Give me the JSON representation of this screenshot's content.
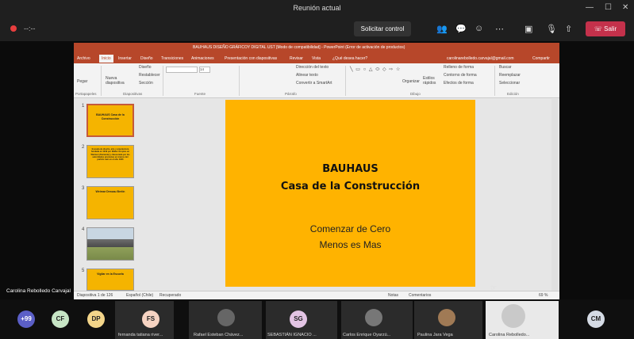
{
  "window": {
    "title": "Reunión actual",
    "minimize": "—",
    "maximize": "☐",
    "close": "✕"
  },
  "callbar": {
    "timer": "--:--",
    "request_control": "Solicitar control",
    "leave": "Salir",
    "icons": [
      "people-icon",
      "chat-icon",
      "reactions-icon",
      "more-icon",
      "camera-off-icon",
      "mic-off-icon",
      "share-icon"
    ]
  },
  "ppt": {
    "title": "BAUHAUS DISEÑO GRÁFICOY DIGITAL UST [Modo de compatibilidad] - PowerPoint (Error de activación de productos)",
    "tabs": [
      "Archivo",
      "Inicio",
      "Insertar",
      "Diseño",
      "Transiciones",
      "Animaciones",
      "Presentación con diapositivas",
      "Revisar",
      "Vista",
      "¿Qué desea hacer?"
    ],
    "active_tab": "Inicio",
    "account": "carolinarebolledo.carvajal@gmail.com",
    "share": "Compartir",
    "ribbon": {
      "paste": "Pegar",
      "new_slide": "Nueva diapositiva",
      "design": "Diseño",
      "reset": "Restablecer",
      "section": "Sección",
      "font_size": "14",
      "text_direction": "Dirección del texto",
      "align_text": "Alinear texto",
      "smartart": "Convertir a SmartArt",
      "arrange": "Organizar",
      "quick_styles": "Estilos rápidos",
      "shape_fill": "Relleno de forma",
      "shape_outline": "Contorno de forma",
      "shape_effects": "Efectos de forma",
      "find": "Buscar",
      "replace": "Reemplazar",
      "select": "Seleccionar",
      "groups": [
        "Portapapeles",
        "Diapositivas",
        "Fuente",
        "Párrafo",
        "Dibujo",
        "Edición"
      ]
    },
    "thumbnails": [
      {
        "num": "1",
        "text": "BAUHAUS Casa de la Construcción"
      },
      {
        "num": "2",
        "text": "Escuela de diseño, arte y arquitectura fundada en 1919 por Walter Gropius en Weimar (Alemania) y clausurada por las autoridades prusianas en manos del partido nazi en el año 1933"
      },
      {
        "num": "3",
        "text": "Weimar Dessau Berlín"
      },
      {
        "num": "4",
        "text": ""
      },
      {
        "num": "5",
        "text": "Vigilar en la Escuela"
      }
    ],
    "slide": {
      "title_line1": "BAUHAUS",
      "title_line2": "Casa de la Construcción",
      "sub_line1": "Comenzar de Cero",
      "sub_line2": "Menos es Mas"
    },
    "status": {
      "slide_info": "Diapositiva 1 de 126",
      "language": "Español (Chile)",
      "recovered": "Recuperado",
      "notes": "Notas",
      "comments": "Comentarios",
      "zoom": "69 %"
    }
  },
  "speaker": "Carolina Rebolledo Carvajal",
  "participants": [
    {
      "initials": "+99",
      "name": "",
      "color": "#5b5fc7"
    },
    {
      "initials": "CF",
      "name": "",
      "color": "#c7e5c5"
    },
    {
      "initials": "DP",
      "name": "",
      "color": "#f3d58a"
    },
    {
      "initials": "FS",
      "name": "fernanda tatiana river...",
      "color": "#f6d3c2"
    },
    {
      "initials": "",
      "name": "Rafael Esteban Chávez...",
      "color": "#444"
    },
    {
      "initials": "SG",
      "name": "SEBASTIÁN IGNACIO ...",
      "color": "#e3c4e4"
    },
    {
      "initials": "",
      "name": "Carlos Enrique Oyarzú...",
      "color": "#444"
    },
    {
      "initials": "",
      "name": "Paulina Jara Vega",
      "color": "#444"
    },
    {
      "initials": "",
      "name": "Carolina Rebolledo...",
      "color": "#ddd"
    },
    {
      "initials": "CM",
      "name": "",
      "color": "#d5dbe5"
    }
  ]
}
